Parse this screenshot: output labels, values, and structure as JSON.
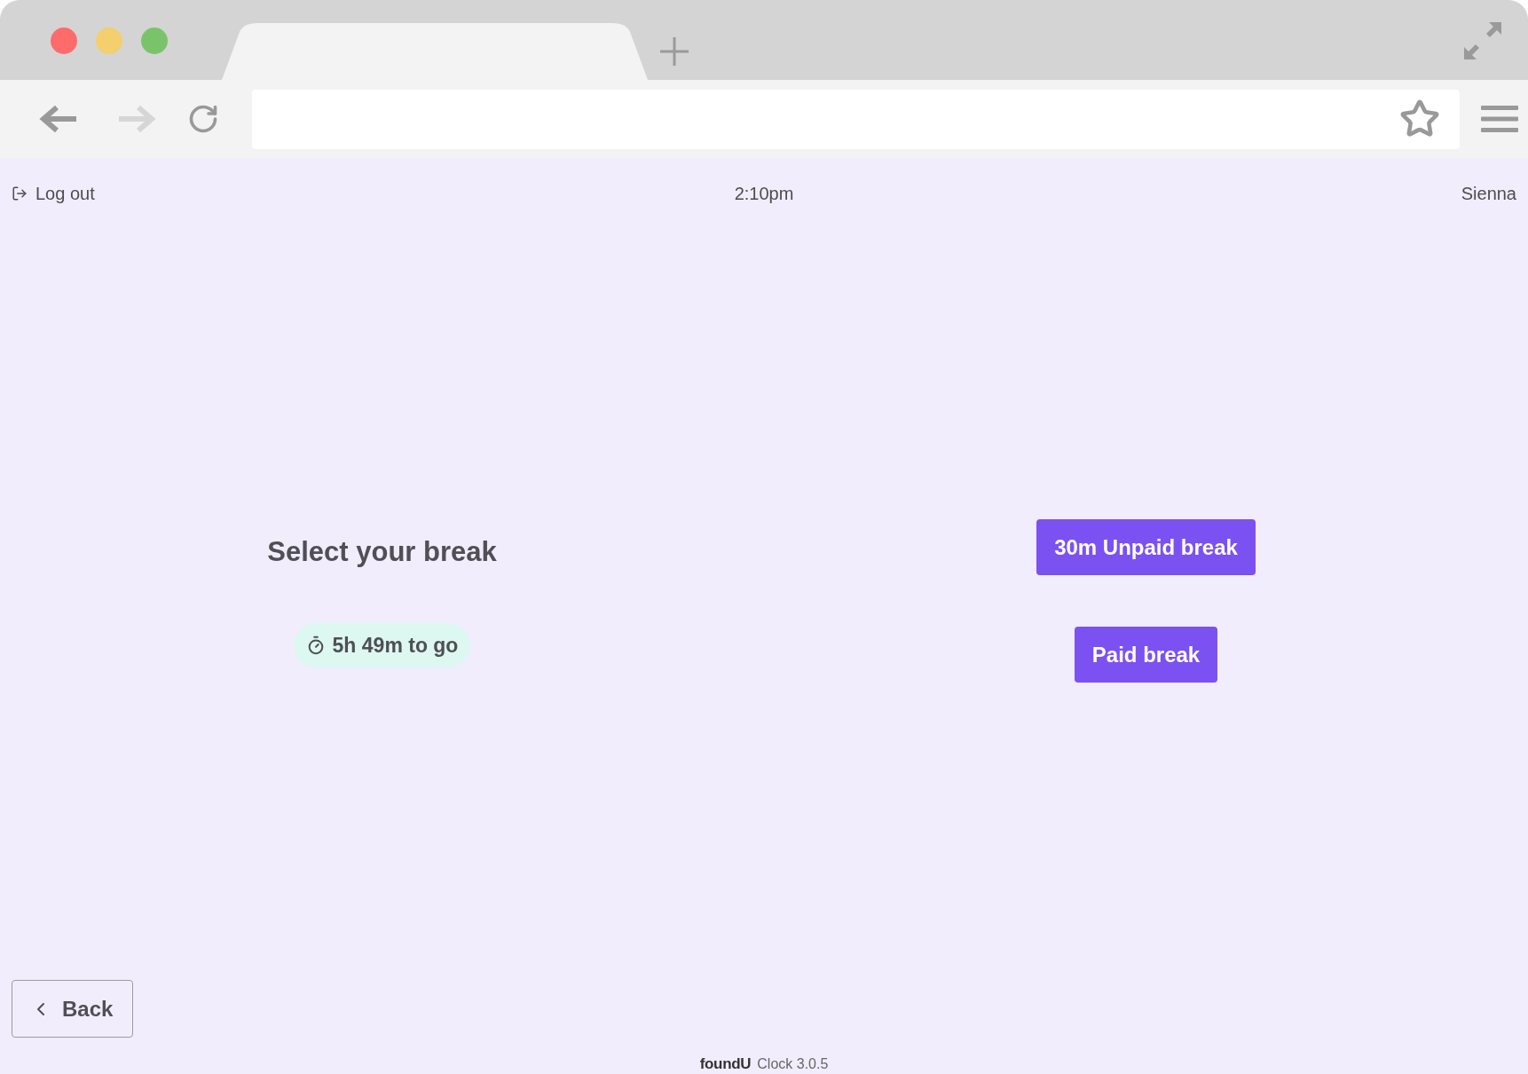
{
  "header": {
    "logout": "Log out",
    "time": "2:10pm",
    "user": "Sienna"
  },
  "break_panel": {
    "title": "Select your break",
    "remaining": "5h 49m to go"
  },
  "break_options": [
    "30m Unpaid break",
    "Paid break"
  ],
  "back_button": "Back",
  "footer": {
    "logo": "foundU",
    "version": "Clock 3.0.5"
  }
}
